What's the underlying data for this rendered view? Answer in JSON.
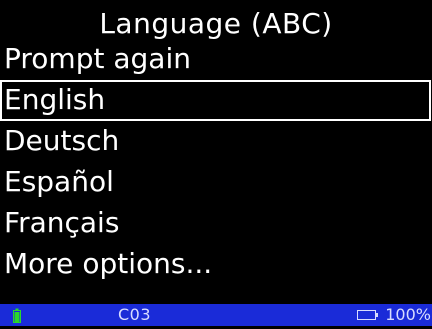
{
  "screen": {
    "title": "Language (ABC)"
  },
  "menu": {
    "items": [
      {
        "label": "Prompt again",
        "selected": false
      },
      {
        "label": "English",
        "selected": true
      },
      {
        "label": "Deutsch",
        "selected": false
      },
      {
        "label": "Español",
        "selected": false
      },
      {
        "label": "Français",
        "selected": false
      },
      {
        "label": "More options...",
        "selected": false
      }
    ]
  },
  "status": {
    "code": "C03",
    "battery_percent": "100%",
    "background_color": "#1a2bd8",
    "charging_indicator_color": "#2bd82b",
    "icons": [
      "charging-battery-icon",
      "battery-icon"
    ]
  }
}
